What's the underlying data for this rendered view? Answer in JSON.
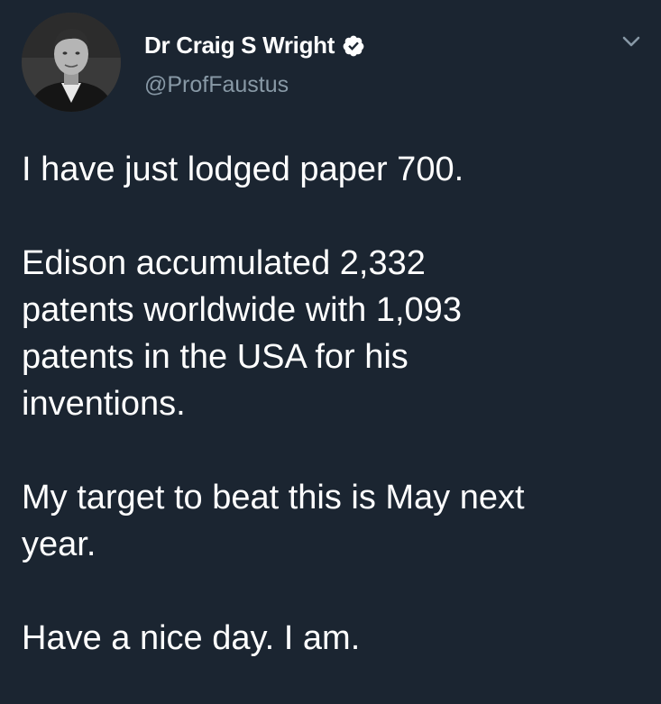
{
  "tweet": {
    "display_name": "Dr Craig S Wright",
    "handle": "@ProfFaustus",
    "verified": true,
    "icons": {
      "verified": "verified-badge-icon",
      "menu": "chevron-down-icon",
      "avatar": "profile-photo"
    },
    "colors": {
      "background": "#1b2531",
      "text": "#ffffff",
      "handle": "#8899a6",
      "chevron": "#8899a6"
    },
    "paragraphs": [
      [
        "I have just lodged paper 700."
      ],
      [
        "Edison accumulated 2,332",
        "patents worldwide with 1,093",
        "patents in the USA for his",
        "inventions."
      ],
      [
        "My target to beat this is May next",
        "year."
      ],
      [
        "Have a nice day. I am."
      ]
    ]
  }
}
